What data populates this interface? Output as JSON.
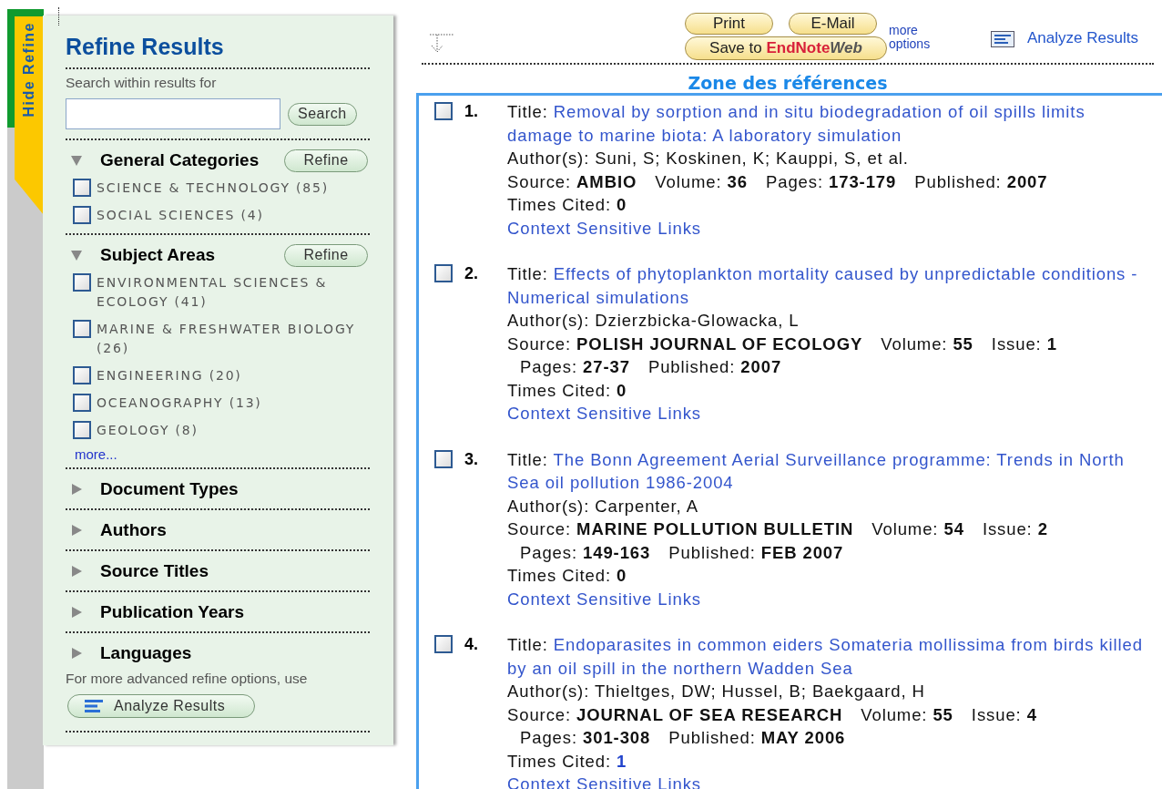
{
  "side_tab": {
    "label": "Hide Refine"
  },
  "refine": {
    "title": "Refine Results",
    "search_label": "Search within results for",
    "search_button": "Search",
    "open_groups": [
      {
        "title": "General Categories",
        "expanded": true,
        "button": "Refine",
        "items": [
          {
            "label": "SCIENCE & TECHNOLOGY (85)",
            "checked": false
          },
          {
            "label": "SOCIAL SCIENCES (4)",
            "checked": false
          }
        ]
      },
      {
        "title": "Subject Areas",
        "expanded": true,
        "button": "Refine",
        "items": [
          {
            "label": "ENVIRONMENTAL SCIENCES & ECOLOGY (41)",
            "checked": false
          },
          {
            "label": "MARINE & FRESHWATER BIOLOGY (26)",
            "checked": false
          },
          {
            "label": "ENGINEERING (20)",
            "checked": false
          },
          {
            "label": "OCEANOGRAPHY (13)",
            "checked": false
          },
          {
            "label": "GEOLOGY (8)",
            "checked": false
          }
        ],
        "more": "more..."
      }
    ],
    "closed_groups": [
      {
        "title": "Document Types",
        "expanded": false
      },
      {
        "title": "Authors",
        "expanded": false
      },
      {
        "title": "Source Titles",
        "expanded": false
      },
      {
        "title": "Publication Years",
        "expanded": false
      },
      {
        "title": "Languages",
        "expanded": false
      }
    ],
    "advanced_text": "For more advanced refine options, use",
    "analyze_button": "Analyze Results"
  },
  "toolbar": {
    "print": "Print",
    "email": "E-Mail",
    "save_prefix": "Save to",
    "save_brand": "EndNote",
    "save_brand_suffix": "Web",
    "more_options": "more options",
    "analyze": "Analyze Results"
  },
  "zone_title": "Zone des références",
  "references": [
    {
      "number": "1.",
      "checked": false,
      "title_label": "Title:",
      "title": "Removal by sorption and in situ biodegradation of oil spills limits damage to marine biota: A laboratory simulation",
      "authors": "Author(s): Suni, S; Koskinen, K; Kauppi, S, et al.",
      "source_label": "Source:",
      "source": [
        {
          "value": "AMBIO"
        },
        {
          "label": "Volume:",
          "value": "36"
        },
        {
          "label": "Pages:",
          "value": "173-179"
        },
        {
          "label": "Published:",
          "value": "2007"
        }
      ],
      "cited_label": "Times Cited:",
      "cited": "0",
      "cited_link": false,
      "links": "Context Sensitive Links"
    },
    {
      "number": "2.",
      "checked": false,
      "title_label": "Title:",
      "title": "Effects of phytoplankton mortality caused by unpredictable conditions - Numerical simulations",
      "authors": "Author(s): Dzierzbicka-Glowacka, L",
      "source_label": "Source:",
      "source": [
        {
          "value": "POLISH JOURNAL OF ECOLOGY"
        },
        {
          "label": "Volume:",
          "value": "55"
        },
        {
          "label": "Issue:",
          "value": "1"
        },
        {
          "label": "Pages:",
          "value": "27-37"
        },
        {
          "label": "Published:",
          "value": "2007"
        }
      ],
      "cited_label": "Times Cited:",
      "cited": "0",
      "cited_link": false,
      "links": "Context Sensitive Links"
    },
    {
      "number": "3.",
      "checked": false,
      "title_label": "Title:",
      "title": "The Bonn Agreement Aerial Surveillance programme: Trends in North Sea oil pollution 1986-2004",
      "authors": "Author(s): Carpenter, A",
      "source_label": "Source:",
      "source": [
        {
          "value": "MARINE POLLUTION BULLETIN"
        },
        {
          "label": "Volume:",
          "value": "54"
        },
        {
          "label": "Issue:",
          "value": "2"
        },
        {
          "label": "Pages:",
          "value": "149-163"
        },
        {
          "label": "Published:",
          "value": "FEB 2007"
        }
      ],
      "cited_label": "Times Cited:",
      "cited": "0",
      "cited_link": false,
      "links": "Context Sensitive Links"
    },
    {
      "number": "4.",
      "checked": false,
      "title_label": "Title:",
      "title": "Endoparasites in common eiders Somateria mollissima from birds killed by an oil spill in the northern Wadden Sea",
      "authors": "Author(s): Thieltges, DW; Hussel, B; Baekgaard, H",
      "source_label": "Source:",
      "source": [
        {
          "value": "JOURNAL OF SEA RESEARCH"
        },
        {
          "label": "Volume:",
          "value": "55"
        },
        {
          "label": "Issue:",
          "value": "4"
        },
        {
          "label": "Pages:",
          "value": "301-308"
        },
        {
          "label": "Published:",
          "value": "MAY 2006"
        }
      ],
      "cited_label": "Times Cited:",
      "cited": "1",
      "cited_link": true,
      "links": "Context Sensitive Links"
    }
  ]
}
